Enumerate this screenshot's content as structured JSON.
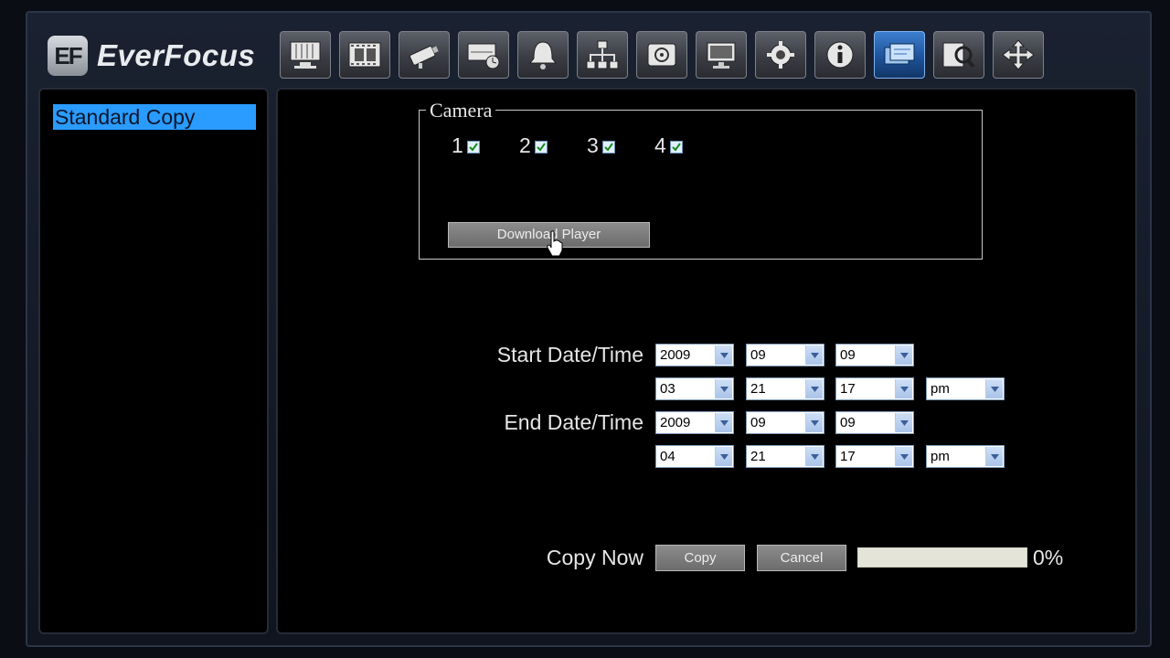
{
  "brand": {
    "logo_mark": "EF",
    "name": "EverFocus"
  },
  "toolbar": [
    {
      "name": "live-view",
      "icon": "monitor-icon"
    },
    {
      "name": "playback",
      "icon": "film-icon"
    },
    {
      "name": "camera",
      "icon": "camera-icon"
    },
    {
      "name": "record",
      "icon": "record-schedule-icon"
    },
    {
      "name": "alarm",
      "icon": "bell-icon"
    },
    {
      "name": "network",
      "icon": "network-icon"
    },
    {
      "name": "disk",
      "icon": "disk-icon"
    },
    {
      "name": "display",
      "icon": "display-icon"
    },
    {
      "name": "system",
      "icon": "gear-icon"
    },
    {
      "name": "info",
      "icon": "info-icon"
    },
    {
      "name": "backup",
      "icon": "backup-icon",
      "active": true
    },
    {
      "name": "search",
      "icon": "search-icon"
    },
    {
      "name": "ptz",
      "icon": "move-arrows-icon"
    }
  ],
  "sidebar": {
    "items": [
      {
        "label": "Standard Copy",
        "selected": true
      }
    ]
  },
  "camera": {
    "legend": "Camera",
    "items": [
      {
        "label": "1",
        "checked": true
      },
      {
        "label": "2",
        "checked": true
      },
      {
        "label": "3",
        "checked": true
      },
      {
        "label": "4",
        "checked": true
      }
    ],
    "download_label": "Download Player"
  },
  "start": {
    "label": "Start Date/Time",
    "year": "2009",
    "month": "09",
    "day": "09",
    "hour": "03",
    "minute": "21",
    "second": "17",
    "ampm": "pm"
  },
  "end": {
    "label": "End Date/Time",
    "year": "2009",
    "month": "09",
    "day": "09",
    "hour": "04",
    "minute": "21",
    "second": "17",
    "ampm": "pm"
  },
  "copy": {
    "label": "Copy Now",
    "copy_button": "Copy",
    "cancel_button": "Cancel",
    "progress_percent": 0,
    "progress_text": "0%"
  },
  "colors": {
    "selection": "#2a9bff",
    "active_tool": "#1c4f95"
  }
}
